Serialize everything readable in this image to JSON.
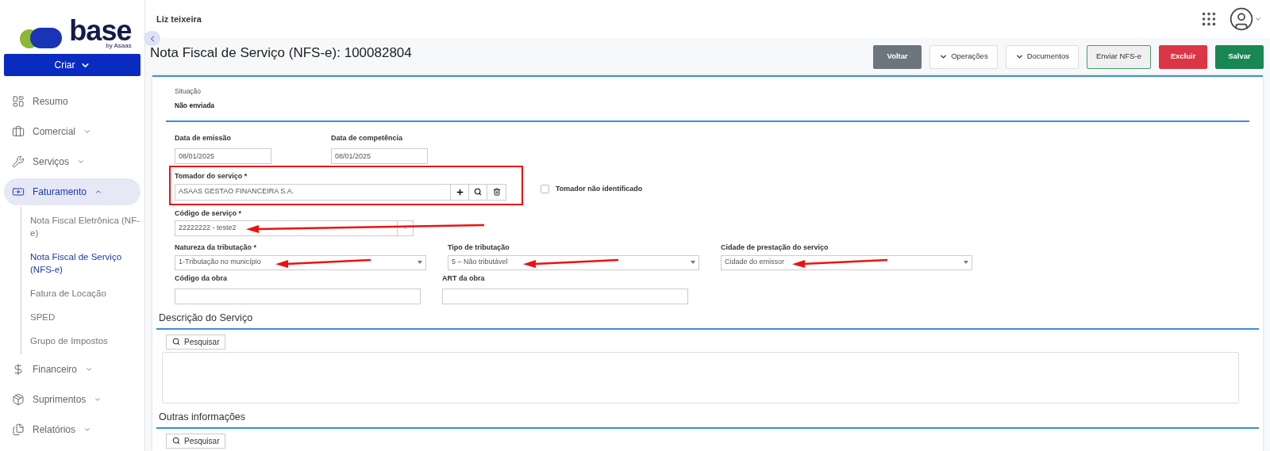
{
  "logo": {
    "name": "base",
    "tagline": "by Asaas"
  },
  "create_button": {
    "label": "Criar"
  },
  "sidebar": {
    "items": [
      {
        "label": "Resumo",
        "expandable": false,
        "selected": false
      },
      {
        "label": "Comercial",
        "expandable": true,
        "expanded": false,
        "selected": false
      },
      {
        "label": "Serviços",
        "expandable": true,
        "expanded": false,
        "selected": false
      },
      {
        "label": "Faturamento",
        "expandable": true,
        "expanded": true,
        "selected": true,
        "children": [
          {
            "label": "Nota Fiscal Eletrônica  (NF-e)",
            "selected": false
          },
          {
            "label": "Nota Fiscal de Serviço (NFS-e)",
            "selected": true
          },
          {
            "label": "Fatura de Locação",
            "selected": false
          },
          {
            "label": "SPED",
            "selected": false
          },
          {
            "label": "Grupo de Impostos",
            "selected": false
          }
        ]
      },
      {
        "label": "Financeiro",
        "expandable": true,
        "expanded": false,
        "selected": false
      },
      {
        "label": "Suprimentos",
        "expandable": true,
        "expanded": false,
        "selected": false
      },
      {
        "label": "Relatórios",
        "expandable": true,
        "expanded": false,
        "selected": false
      }
    ]
  },
  "topbar": {
    "user": "Liz teixeira"
  },
  "page_title": "Nota Fiscal de Serviço (NFS-e): 100082804",
  "actions": [
    {
      "label": "Voltar",
      "kind": "secondary"
    },
    {
      "label": "Operações",
      "kind": "dropdown"
    },
    {
      "label": "Documentos",
      "kind": "dropdown"
    },
    {
      "label": "Enviar NFS-e",
      "kind": "outline"
    },
    {
      "label": "Excluir",
      "kind": "danger"
    },
    {
      "label": "Salvar",
      "kind": "success"
    }
  ],
  "status": {
    "label": "Situação",
    "value": "Não enviada"
  },
  "form": {
    "rows": [
      [
        {
          "kind": "date",
          "label": "Data de emissão",
          "value": "08/01/2025"
        },
        {
          "kind": "date",
          "label": "Data de competência",
          "value": "08/01/2025"
        }
      ],
      [
        {
          "kind": "lookup",
          "label": "Tomador do serviço *",
          "value": "ASAAS GESTAO FINANCEIRA S.A.",
          "highlighted": true
        },
        {
          "kind": "checkbox",
          "label": "Tomador não identificado",
          "checked": false
        }
      ],
      [
        {
          "kind": "combo",
          "label": "Código de serviço *",
          "value": "22222222 - teste2",
          "annotated": true
        }
      ],
      [
        {
          "kind": "select",
          "label": "Natureza da tributação *",
          "value": "1-Tributação no município",
          "annotated": true
        },
        {
          "kind": "select",
          "label": "Tipo de tributação",
          "value": "5 – Não tributável",
          "annotated": true
        },
        {
          "kind": "select",
          "label": "Cidade de prestação do serviço",
          "value": "Cidade do emissor",
          "annotated": true
        }
      ],
      [
        {
          "kind": "text",
          "label": "Código da obra"
        },
        {
          "kind": "text",
          "label": "ART da obra"
        }
      ]
    ]
  },
  "sections": [
    {
      "title": "Descrição do Serviço",
      "search_button": "Pesquisar",
      "has_textarea": true
    },
    {
      "title": "Outras informações",
      "search_button": "Pesquisar",
      "has_textarea": false
    }
  ]
}
